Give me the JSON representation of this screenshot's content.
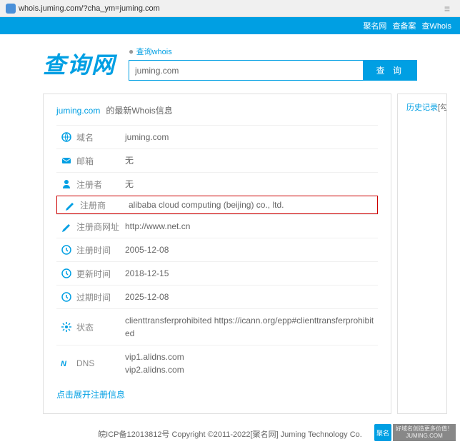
{
  "browser": {
    "url": "whois.juming.com/?cha_ym=juming.com"
  },
  "topnav": {
    "links": [
      "聚名网",
      "查备案",
      "查Whois"
    ]
  },
  "logo": "查询网",
  "search": {
    "whois_link": "查询whois",
    "value": "juming.com",
    "button": "查 询"
  },
  "panel": {
    "domain": "juming.com",
    "title_suffix": "的最新Whois信息"
  },
  "rows": [
    {
      "icon": "globe",
      "label": "域名",
      "value": "juming.com"
    },
    {
      "icon": "mail",
      "label": "邮箱",
      "value": "无"
    },
    {
      "icon": "user",
      "label": "注册者",
      "value": "无"
    },
    {
      "icon": "pen",
      "label": "注册商",
      "value": "alibaba cloud computing (beijing) co., ltd.",
      "hl": true
    },
    {
      "icon": "pen",
      "label": "注册商网址",
      "value": "http://www.net.cn"
    },
    {
      "icon": "clock",
      "label": "注册时间",
      "value": "2005-12-08"
    },
    {
      "icon": "clock",
      "label": "更新时间",
      "value": "2018-12-15"
    },
    {
      "icon": "clock",
      "label": "过期时间",
      "value": "2025-12-08"
    },
    {
      "icon": "gear",
      "label": "状态",
      "value": "clienttransferprohibited https://icann.org/epp#clienttransferprohibited"
    },
    {
      "icon": "dns",
      "label": "DNS",
      "value": "vip1.alidns.com\nvip2.alidns.com"
    }
  ],
  "expand": "点击展开注册信息",
  "side": {
    "history": "历史记录",
    "hint": "[勾选可对比"
  },
  "footer": {
    "text": "皖ICP备12013812号 Copyright ©2011-2022[聚名网] Juming Technology Co.",
    "brand": "聚名",
    "slogan1": "好域名创造更多价值！",
    "slogan2": "JUMING.COM"
  }
}
